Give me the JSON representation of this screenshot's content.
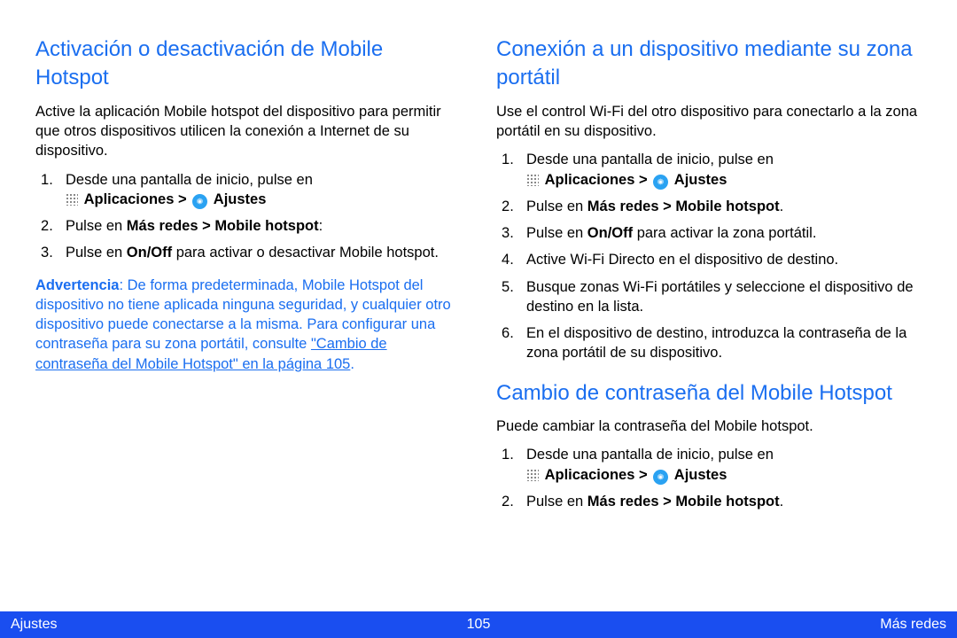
{
  "left": {
    "heading": "Activación o desactivación de Mobile Hotspot",
    "intro": "Active la aplicación Mobile hotspot del dispositivo para permitir que otros dispositivos utilicen la conexión a Internet de su dispositivo.",
    "step1_a": "Desde una pantalla de inicio, pulse en",
    "apps_label": "Aplicaciones > ",
    "settings_label": "Ajustes",
    "step2_a": "Pulse en ",
    "step2_b": "Más redes > Mobile hotspot",
    "step2_c": ":",
    "step3_a": "Pulse en ",
    "step3_b": "On/Off",
    "step3_c": " para activar o desactivar Mobile hotspot.",
    "warn_lead": "Advertencia",
    "warn_body": ": De forma predeterminada, Mobile Hotspot del dispositivo no tiene aplicada ninguna seguridad, y cualquier otro dispositivo puede conectarse a la misma. Para configurar una contraseña para su zona portátil, consulte ",
    "warn_link": "\"Cambio de contraseña del Mobile Hotspot\" en la página 105",
    "warn_end": "."
  },
  "right": {
    "heading1": "Conexión a un dispositivo mediante su zona portátil",
    "intro1": "Use el control Wi-Fi del otro dispositivo para conectarlo a la zona portátil en su dispositivo.",
    "r1_step1_a": "Desde una pantalla de inicio, pulse en",
    "r1_step2_a": "Pulse en ",
    "r1_step2_b": "Más redes > Mobile hotspot",
    "r1_step2_c": ".",
    "r1_step3_a": "Pulse en ",
    "r1_step3_b": "On/Off",
    "r1_step3_c": " para activar la zona portátil.",
    "r1_step4": "Active Wi-Fi Directo en el dispositivo de destino.",
    "r1_step5": "Busque zonas Wi-Fi portátiles y seleccione el dispositivo de destino en la lista.",
    "r1_step6": "En el dispositivo de destino, introduzca la contraseña de la zona portátil de su dispositivo.",
    "heading2": "Cambio de contraseña del Mobile Hotspot",
    "intro2": "Puede cambiar la contraseña del Mobile hotspot.",
    "r2_step1_a": "Desde una pantalla de inicio, pulse en",
    "r2_step2_a": "Pulse en ",
    "r2_step2_b": "Más redes > Mobile hotspot",
    "r2_step2_c": "."
  },
  "footer": {
    "left": "Ajustes",
    "center": "105",
    "right": "Más redes"
  },
  "icons": {
    "grid": "apps-grid-icon",
    "gear": "settings-gear-icon"
  }
}
